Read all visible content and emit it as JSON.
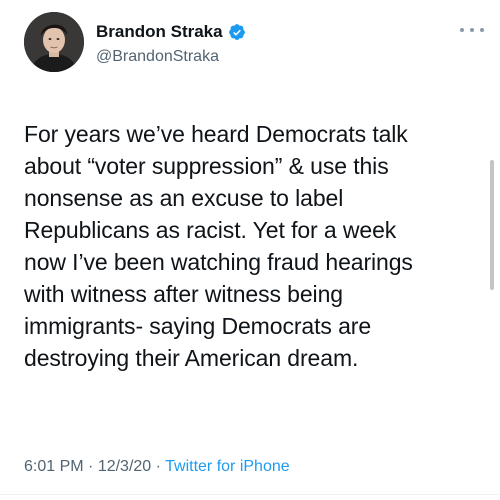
{
  "author": {
    "display_name": "Brandon Straka",
    "handle": "@BrandonStraka",
    "verified": true
  },
  "tweet": {
    "lines": [
      "For years we’ve heard Democrats talk",
      "about “voter suppression” & use this",
      "nonsense as an excuse to label",
      "Republicans as racist. Yet for a week",
      "now I’ve been watching fraud hearings",
      "with witness after witness being",
      "immigrants- saying Democrats are",
      "destroying their American dream."
    ]
  },
  "meta": {
    "time": "6:01 PM",
    "sep1": " · ",
    "date": "12/3/20",
    "sep2": " · ",
    "source": "Twitter for iPhone"
  },
  "icons": {
    "verified": "verified-badge-icon",
    "more": "more-options-icon"
  },
  "colors": {
    "text": "#0f1419",
    "secondary": "#536471",
    "accent": "#1d9bf0"
  }
}
